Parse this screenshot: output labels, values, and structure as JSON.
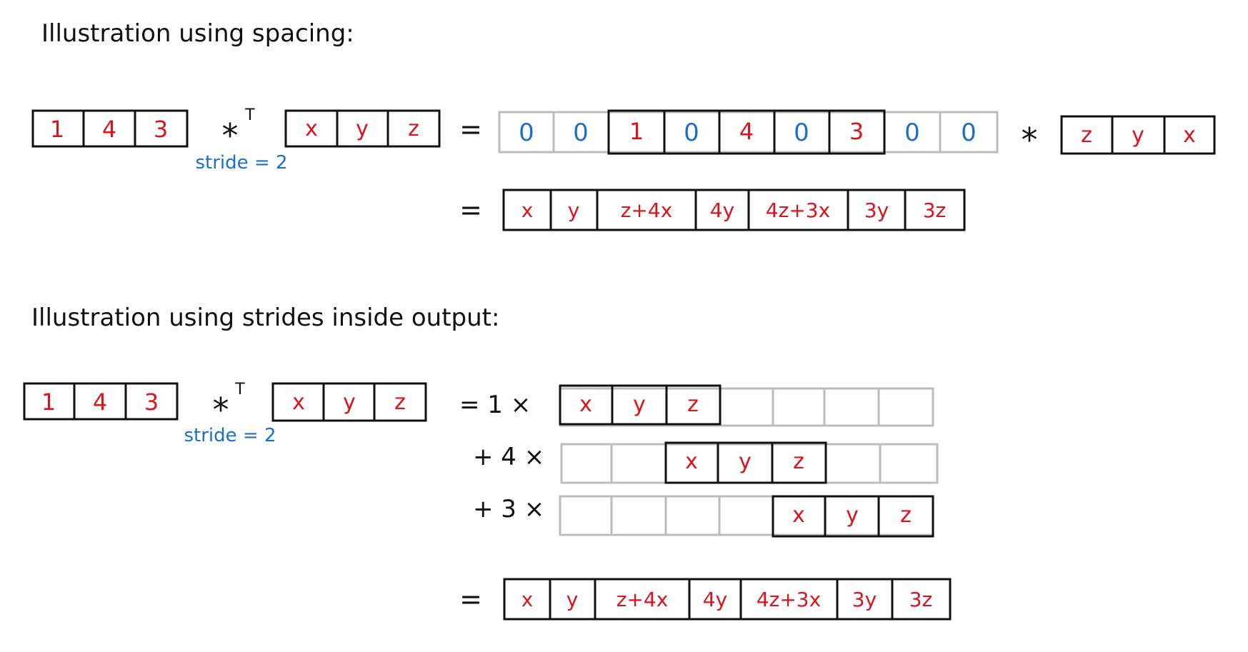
{
  "colors": {
    "ink": "#111111",
    "red": "#d8141c",
    "blue": "#1a6fc8",
    "grey": "#bcbcbc"
  },
  "section1": {
    "title": "Illustration using spacing:",
    "input": [
      "1",
      "4",
      "3"
    ],
    "conv_symbol": "*",
    "transpose_mark": "T",
    "stride_label": "stride = 2",
    "kernel": [
      "x",
      "y",
      "z"
    ],
    "equals": "=",
    "padded": [
      "0",
      "0",
      "1",
      "0",
      "4",
      "0",
      "3",
      "0",
      "0"
    ],
    "star": "*",
    "flipped_kernel": [
      "z",
      "y",
      "x"
    ],
    "result_equals": "=",
    "result": [
      "x",
      "y",
      "z+4x",
      "4y",
      "4z+3x",
      "3y",
      "3z"
    ]
  },
  "section2": {
    "title": "Illustration using strides inside output:",
    "input": [
      "1",
      "4",
      "3"
    ],
    "conv_symbol": "*",
    "transpose_mark": "T",
    "stride_label": "stride = 2",
    "kernel": [
      "x",
      "y",
      "z"
    ],
    "rows": [
      {
        "prefix": "= 1 ×",
        "cells": [
          "x",
          "y",
          "z"
        ]
      },
      {
        "prefix": "+ 4 ×",
        "cells": [
          "x",
          "y",
          "z"
        ]
      },
      {
        "prefix": "+ 3 ×",
        "cells": [
          "x",
          "y",
          "z"
        ]
      }
    ],
    "result_equals": "=",
    "result": [
      "x",
      "y",
      "z+4x",
      "4y",
      "4z+3x",
      "3y",
      "3z"
    ]
  }
}
